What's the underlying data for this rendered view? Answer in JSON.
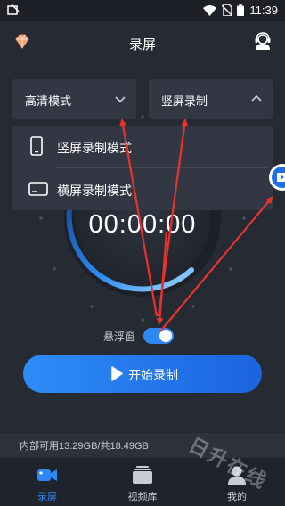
{
  "statusbar": {
    "time": "11:39"
  },
  "appbar": {
    "title": "录屏"
  },
  "dropdowns": {
    "quality": {
      "label": "高清模式"
    },
    "orientation": {
      "label": "竖屏录制"
    }
  },
  "menu": {
    "items": [
      {
        "label": "竖屏录制模式",
        "icon": "phone-portrait-icon"
      },
      {
        "label": "横屏录制模式",
        "icon": "phone-landscape-icon"
      }
    ]
  },
  "timer": {
    "value": "00:00:00"
  },
  "floating_window": {
    "label": "悬浮窗",
    "enabled": true
  },
  "start_button": {
    "label": "开始录制"
  },
  "storage": {
    "text": "内部可用13.29GB/共18.49GB"
  },
  "tabs": [
    {
      "label": "录屏",
      "icon": "video-camera-icon",
      "active": true
    },
    {
      "label": "视频库",
      "icon": "video-library-icon",
      "active": false
    },
    {
      "label": "我的",
      "icon": "user-icon",
      "active": false
    }
  ],
  "watermark": {
    "text": "日升在线"
  },
  "colors": {
    "accent": "#2f86f5",
    "background": "#262a33",
    "annotation_arrow": "#e8322b"
  }
}
